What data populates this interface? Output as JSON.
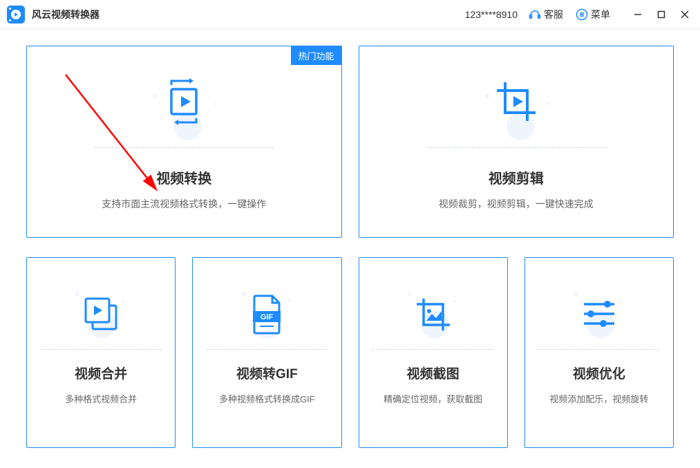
{
  "header": {
    "app_title": "风云视频转换器",
    "account": "123****8910",
    "service_label": "客服",
    "menu_label": "菜单"
  },
  "cards": {
    "hot_badge": "热门功能",
    "video_convert": {
      "title": "视频转换",
      "desc": "支持市面主流视频格式转换，一键操作"
    },
    "video_edit": {
      "title": "视频剪辑",
      "desc": "视频裁剪，视频剪辑，一键快速完成"
    },
    "video_merge": {
      "title": "视频合并",
      "desc": "多种格式视频合并"
    },
    "video_gif": {
      "title": "视频转GIF",
      "desc": "多种视频格式转换成GIF"
    },
    "video_screenshot": {
      "title": "视频截图",
      "desc": "精确定位视频，获取截图"
    },
    "video_optimize": {
      "title": "视频优化",
      "desc": "视频添加配乐，视频旋转"
    }
  }
}
